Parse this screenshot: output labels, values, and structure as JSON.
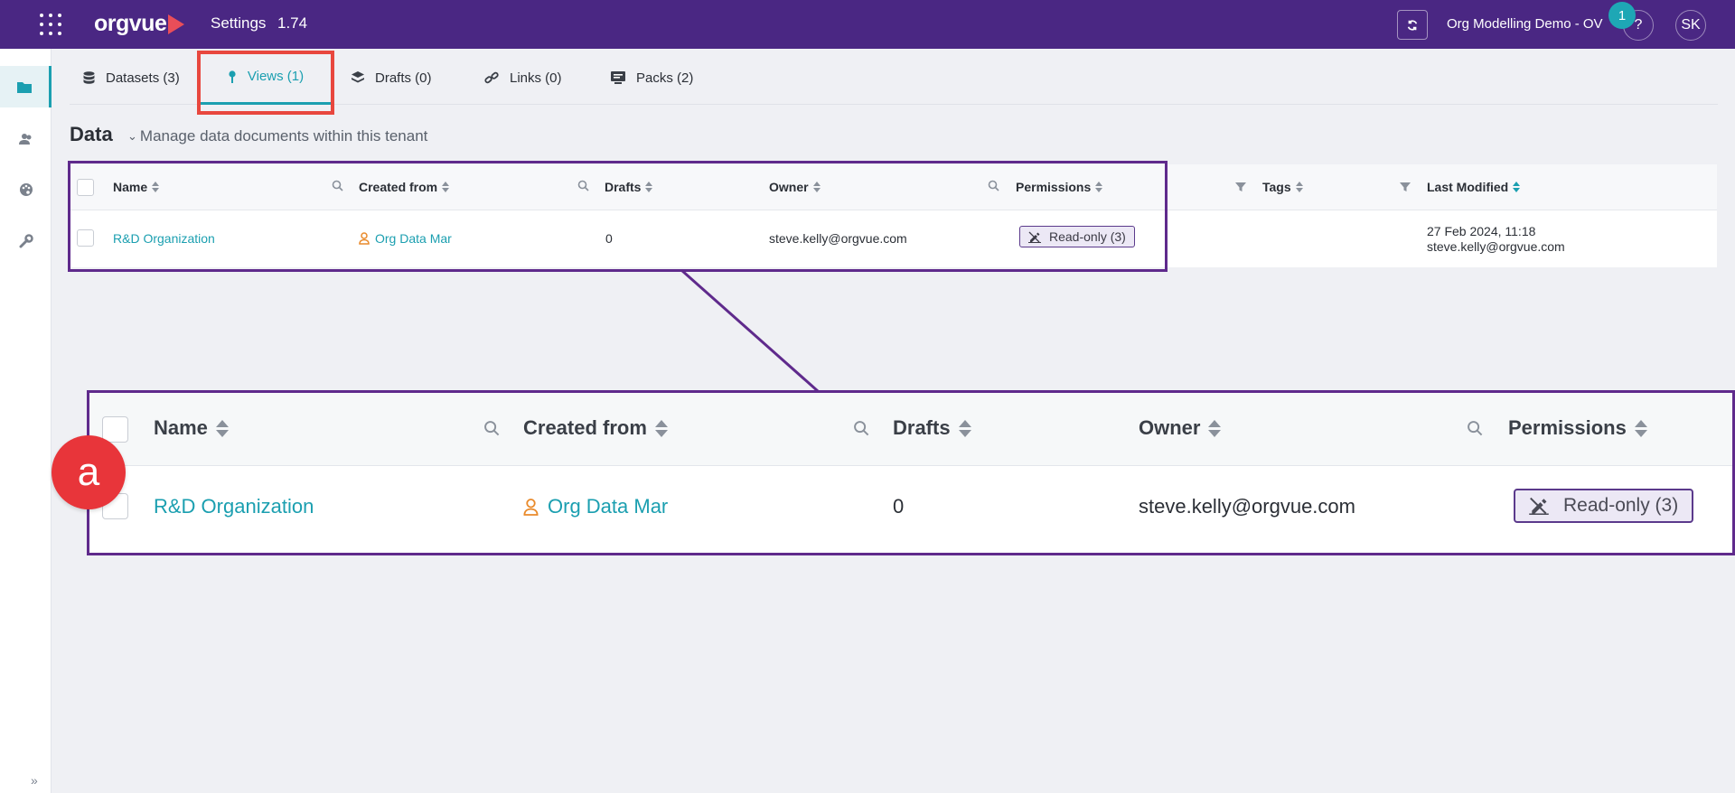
{
  "topbar": {
    "logo": "orgvue",
    "app_title": "Settings",
    "version": "1.74",
    "tenant": "Org Modelling Demo - OV",
    "notification_count": "1",
    "help": "?",
    "user_initials": "SK"
  },
  "tabs": [
    {
      "label": "Datasets (3)",
      "icon": "database-icon"
    },
    {
      "label": "Views (1)",
      "icon": "pin-icon"
    },
    {
      "label": "Drafts (0)",
      "icon": "layers-icon"
    },
    {
      "label": "Links (0)",
      "icon": "link-icon"
    },
    {
      "label": "Packs (2)",
      "icon": "pack-icon"
    }
  ],
  "active_tab": "Views (1)",
  "page": {
    "title": "Data",
    "subtitle": "Manage data documents within this tenant"
  },
  "table": {
    "columns": [
      "Name",
      "Created from",
      "Drafts",
      "Owner",
      "Permissions",
      "Tags",
      "Last Modified"
    ],
    "rows": [
      {
        "name": "R&D Organization",
        "created_from": "Org Data Mar",
        "drafts": "0",
        "owner": "steve.kelly@orgvue.com",
        "permissions": "Read-only (3)",
        "tags": "",
        "last_modified_date": "27 Feb 2024, 11:18",
        "last_modified_by": "steve.kelly@orgvue.com"
      }
    ]
  },
  "callout": {
    "marker": "a"
  },
  "colors": {
    "topbar": "#4a2783",
    "accent": "#1b9fb0",
    "highlight": "#e8473e",
    "callout_border": "#5f2a8c",
    "marker": "#e8353a"
  }
}
